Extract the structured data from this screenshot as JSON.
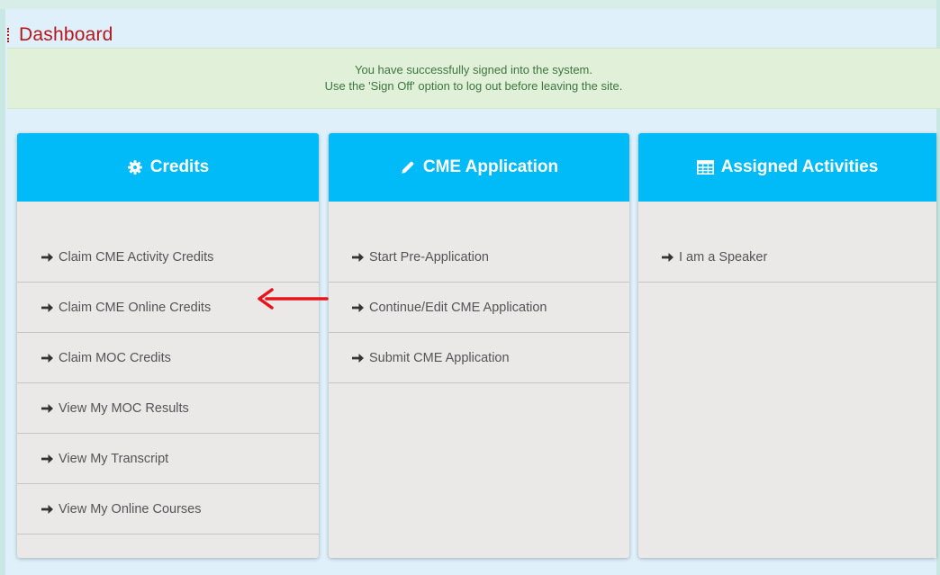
{
  "page": {
    "title": "Dashboard"
  },
  "alert": {
    "line1": "You have successfully signed into the system.",
    "line2": "Use the 'Sign Off' option to log out before leaving the site."
  },
  "panels": [
    {
      "title": "Credits",
      "icon": "gear-icon",
      "items": [
        {
          "label": "Claim CME Activity Credits"
        },
        {
          "label": "Claim CME Online Credits"
        },
        {
          "label": "Claim MOC Credits"
        },
        {
          "label": "View My MOC Results"
        },
        {
          "label": "View My Transcript"
        },
        {
          "label": "View My Online Courses"
        }
      ]
    },
    {
      "title": "CME Application",
      "icon": "pencil-icon",
      "items": [
        {
          "label": "Start Pre-Application"
        },
        {
          "label": "Continue/Edit CME Application"
        },
        {
          "label": "Submit CME Application"
        }
      ]
    },
    {
      "title": "Assigned Activities",
      "icon": "table-icon",
      "items": [
        {
          "label": "I am a Speaker"
        }
      ]
    }
  ],
  "colors": {
    "panel_header": "#00bbf8",
    "title": "#b4161e",
    "alert_text": "#3c763d",
    "alert_bg": "#e0f0d9",
    "annotation_arrow": "#e8141b"
  }
}
